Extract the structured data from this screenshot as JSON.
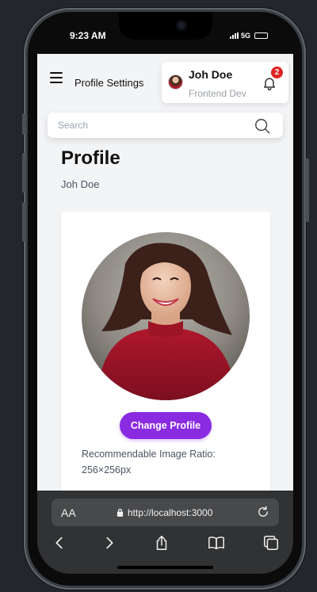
{
  "status_bar": {
    "time": "9:23 AM",
    "network": "5G"
  },
  "header": {
    "page_title": "Profile Settings",
    "user": {
      "name": "Joh Doe",
      "role": "Frontend Dev"
    },
    "notifications": {
      "count": "2"
    }
  },
  "search": {
    "placeholder": "Search",
    "value": ""
  },
  "profile": {
    "title": "Profile",
    "name": "Joh Doe",
    "change_button": "Change Profile",
    "ratio_label": "Recommendable Image Ratio:",
    "ratio_value": "256×256px"
  },
  "browser": {
    "text_size": "AA",
    "url": "http://localhost:3000"
  },
  "colors": {
    "accent": "#8a2be2",
    "badge": "#e02424",
    "background": "#f3f4f6",
    "browser_chrome": "#303234"
  },
  "icons": [
    "menu-icon",
    "bell-icon",
    "search-icon",
    "lock-icon",
    "reload-icon",
    "back-icon",
    "forward-icon",
    "share-icon",
    "bookmarks-icon",
    "tabs-icon"
  ]
}
